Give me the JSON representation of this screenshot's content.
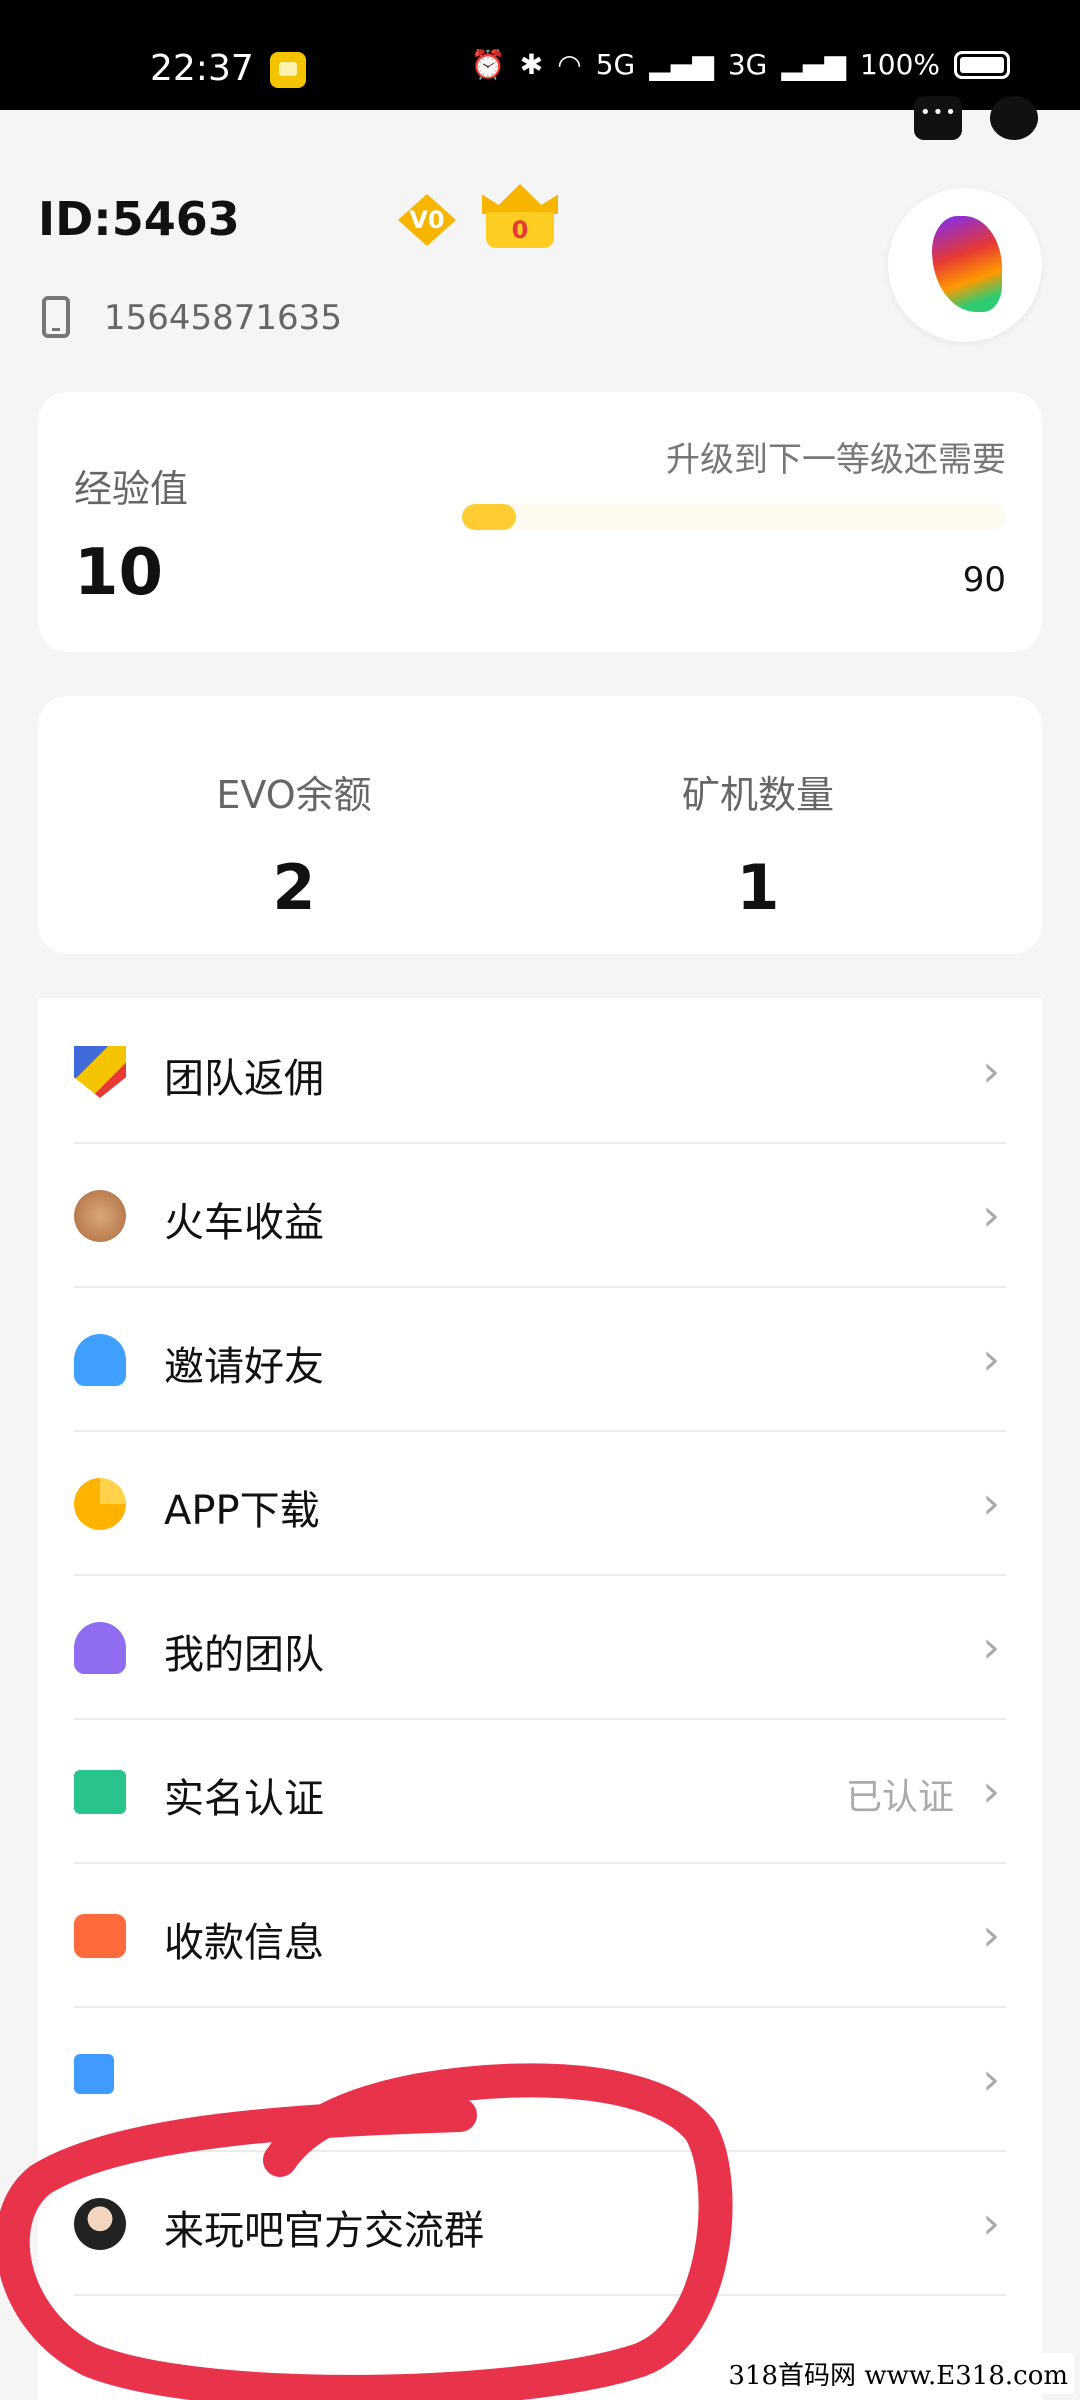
{
  "status_bar": {
    "time": "22:37",
    "network_1": "5G",
    "network_2": "3G",
    "battery": "100%"
  },
  "profile": {
    "id_text": "ID:5463",
    "level_badge": "V0",
    "crown_count": "0",
    "phone": "15645871635"
  },
  "experience": {
    "label": "经验值",
    "value": "10",
    "next_label": "升级到下一等级还需要",
    "needed": "90",
    "progress_fraction": 0.1
  },
  "stats": {
    "evo_label": "EVO余额",
    "evo_value": "2",
    "miners_label": "矿机数量",
    "miners_value": "1"
  },
  "menu": [
    {
      "label": "团队返佣",
      "icon": "team-rebate-icon"
    },
    {
      "label": "火车收益",
      "icon": "coin-icon"
    },
    {
      "label": "邀请好友",
      "icon": "add-user-icon"
    },
    {
      "label": "APP下载",
      "icon": "pie-icon"
    },
    {
      "label": "我的团队",
      "icon": "group-users-icon"
    },
    {
      "label": "实名认证",
      "icon": "id-card-icon",
      "status": "已认证"
    },
    {
      "label": "收款信息",
      "icon": "wallet-icon"
    },
    {
      "label": "",
      "icon": "hidden-item-icon"
    },
    {
      "label": "来玩吧官方交流群",
      "icon": "support-agent-icon"
    }
  ],
  "watermark": "318首码网 www.E318.com",
  "colors": {
    "accent_yellow": "#ffcc33",
    "annotation_red": "#e8334a"
  }
}
